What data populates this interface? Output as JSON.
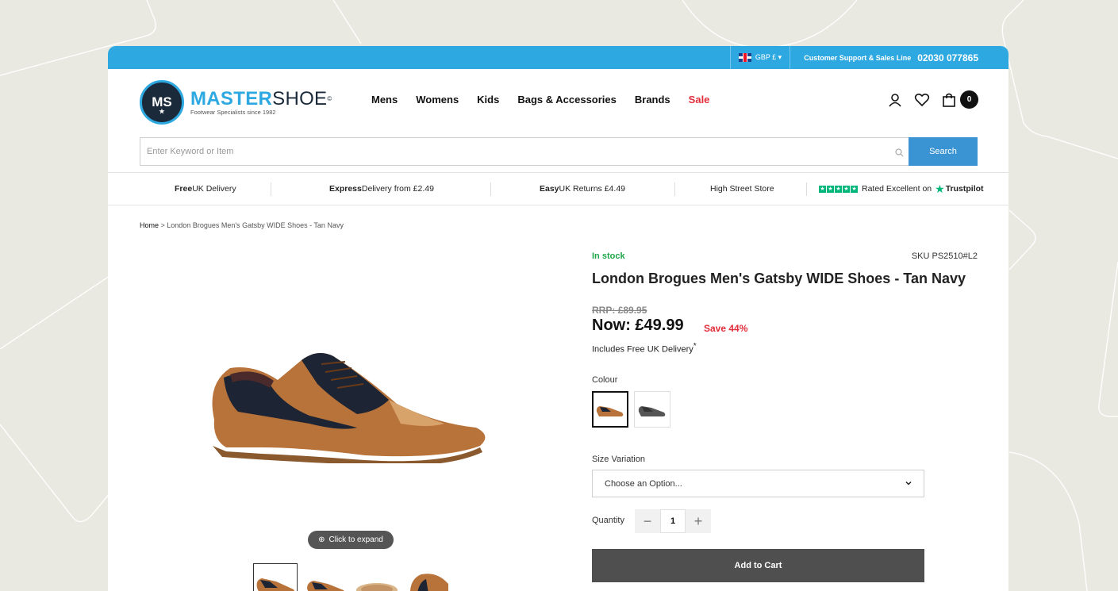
{
  "topbar": {
    "currency": "GBP £ ▾",
    "support_label": "Customer Support & Sales Line",
    "phone": "02030 077865"
  },
  "logo": {
    "badge": "MS",
    "name_a": "MASTER",
    "name_b": "SHOE",
    "reg": "©",
    "tagline": "Footwear Specialists since 1982"
  },
  "nav": [
    {
      "label": "Mens"
    },
    {
      "label": "Womens"
    },
    {
      "label": "Kids"
    },
    {
      "label": "Bags & Accessories"
    },
    {
      "label": "Brands"
    },
    {
      "label": "Sale"
    }
  ],
  "cart": {
    "count": "0"
  },
  "search": {
    "placeholder": "Enter Keyword or Item",
    "button": "Search"
  },
  "usp": {
    "free_bold": "Free",
    "free_rest": " UK Delivery",
    "express_bold": "Express",
    "express_rest": " Delivery from £2.49",
    "returns_bold": "Easy",
    "returns_rest": " UK Returns £4.49",
    "store": "High Street Store",
    "rated": "Rated Excellent on",
    "trustpilot": "Trustpilot"
  },
  "breadcrumb": {
    "home": "Home",
    "sep": " > ",
    "current": "London Brogues Men's Gatsby WIDE Shoes - Tan Navy"
  },
  "gallery": {
    "expand": "Click to expand"
  },
  "product": {
    "stock": "In stock",
    "sku": "SKU PS2510#L2",
    "title": "London Brogues Men's Gatsby WIDE Shoes - Tan Navy",
    "rrp": "RRP: £89.95",
    "now": "Now: £49.99",
    "save": "Save 44%",
    "delivery": "Includes Free UK Delivery",
    "delivery_mark": "*",
    "colour_label": "Colour",
    "size_label": "Size Variation",
    "size_placeholder": "Choose an Option...",
    "qty_label": "Quantity",
    "qty_value": "1",
    "qty_minus": "−",
    "qty_plus": "+",
    "add_to_cart": "Add to Cart"
  },
  "colors": {
    "accent": "#2ea8e0",
    "search_button": "#3a94d3",
    "sale": "#e22d3a",
    "in_stock": "#1ea54a",
    "trustpilot": "#00b67a",
    "add_button": "#4f4f4f"
  }
}
